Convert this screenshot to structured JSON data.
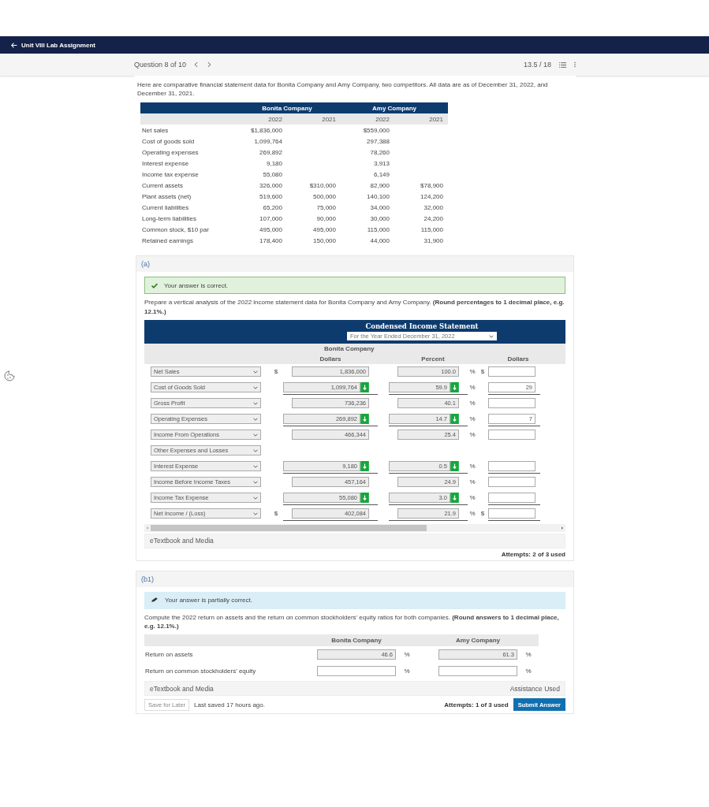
{
  "header": {
    "back_label": "Unit VIII Lab Assignment"
  },
  "question_bar": {
    "position": "Question 8 of 10",
    "score": "13.5 / 18"
  },
  "intro": "Here are comparative financial statement data for Bonita Company and Amy Company, two competitors. All data are as of December 31, 2022, and December 31, 2021.",
  "data_table": {
    "companies": [
      "Bonita Company",
      "Amy Company"
    ],
    "years": [
      "2022",
      "2021",
      "2022",
      "2021"
    ],
    "rows": [
      {
        "label": "Net sales",
        "bonita_2022": "$1,836,000",
        "amy_2022": "$559,000"
      },
      {
        "label": "Cost of goods sold",
        "bonita_2022": "1,099,764",
        "amy_2022": "297,388"
      },
      {
        "label": "Operating expenses",
        "bonita_2022": "269,892",
        "amy_2022": "78,260"
      },
      {
        "label": "Interest expense",
        "bonita_2022": "9,180",
        "amy_2022": "3,913"
      },
      {
        "label": "Income tax expense",
        "bonita_2022": "55,080",
        "amy_2022": "6,149"
      },
      {
        "label": "Current assets",
        "bonita_2022": "326,000",
        "bonita_2021": "$310,000",
        "amy_2022": "82,900",
        "amy_2021": "$78,900"
      },
      {
        "label": "Plant assets (net)",
        "bonita_2022": "519,600",
        "bonita_2021": "500,000",
        "amy_2022": "140,100",
        "amy_2021": "124,200"
      },
      {
        "label": "Current liabilities",
        "bonita_2022": "65,200",
        "bonita_2021": "75,000",
        "amy_2022": "34,000",
        "amy_2021": "32,000"
      },
      {
        "label": "Long-term liabilities",
        "bonita_2022": "107,000",
        "bonita_2021": "90,000",
        "amy_2022": "30,000",
        "amy_2021": "24,200"
      },
      {
        "label": "Common stock, $10 par",
        "bonita_2022": "495,000",
        "bonita_2021": "495,000",
        "amy_2022": "115,000",
        "amy_2021": "115,000"
      },
      {
        "label": "Retained earnings",
        "bonita_2022": "178,400",
        "bonita_2021": "150,000",
        "amy_2022": "44,000",
        "amy_2021": "31,900"
      }
    ]
  },
  "part_a": {
    "label": "(a)",
    "feedback": {
      "kind": "correct",
      "text": "Your answer is correct."
    },
    "instructions": "Prepare a vertical analysis of the 2022 income statement data for Bonita Company and Amy Company. **(Round percentages to 1 decimal place, e.g. 12.1%.)**",
    "statement": {
      "title": "Condensed Income Statement",
      "period": "For the Year Ended December 31, 2022",
      "company": "Bonita Company",
      "columns": [
        "Dollars",
        "Percent",
        "Dollars"
      ],
      "rows": [
        {
          "kind": "line",
          "label": "Net Sales",
          "currency": "$",
          "dollars": "1,836,000",
          "dollars_flag": false,
          "percent": "100.0",
          "percent_flag": false,
          "unit": "%",
          "right_currency": "$",
          "rule": false
        },
        {
          "kind": "line",
          "label": "Cost of Goods Sold",
          "dollars": "1,099,764",
          "dollars_flag": true,
          "percent": "59.9",
          "percent_flag": true,
          "unit": "%",
          "right_value": "29",
          "rule": true
        },
        {
          "kind": "line",
          "label": "Gross Profit",
          "dollars": "736,236",
          "dollars_flag": false,
          "percent": "40.1",
          "percent_flag": false,
          "unit": "%",
          "rule": false
        },
        {
          "kind": "line",
          "label": "Operating Expenses",
          "dollars": "269,892",
          "dollars_flag": true,
          "percent": "14.7",
          "percent_flag": true,
          "unit": "%",
          "right_value": "7",
          "rule": true
        },
        {
          "kind": "line",
          "label": "Income From Operations",
          "dollars": "466,344",
          "dollars_flag": false,
          "percent": "25.4",
          "percent_flag": false,
          "unit": "%",
          "rule": false
        },
        {
          "kind": "heading",
          "label": "Other Expenses and Losses"
        },
        {
          "kind": "line",
          "label": "Interest Expense",
          "dollars": "9,180",
          "dollars_flag": true,
          "percent": "0.5",
          "percent_flag": true,
          "unit": "%",
          "rule": true
        },
        {
          "kind": "line",
          "label": "Income Before Income Taxes",
          "dollars": "457,164",
          "dollars_flag": false,
          "percent": "24.9",
          "percent_flag": false,
          "unit": "%",
          "rule": false
        },
        {
          "kind": "line",
          "label": "Income Tax Expense",
          "dollars": "55,080",
          "dollars_flag": true,
          "percent": "3.0",
          "percent_flag": true,
          "unit": "%",
          "rule": true
        },
        {
          "kind": "line",
          "label": "Net Income / (Loss)",
          "currency": "$",
          "dollars": "402,084",
          "dollars_flag": false,
          "percent": "21.9",
          "percent_flag": false,
          "unit": "%",
          "right_currency": "$",
          "rule": true
        }
      ]
    },
    "media": "eTextbook and Media",
    "attempts": "Attempts: 2 of 3 used"
  },
  "part_b1": {
    "label": "(b1)",
    "feedback": {
      "kind": "partial",
      "text": "Your answer is partially correct."
    },
    "instructions": "Compute the 2022 return on assets and the return on common stockholders' equity ratios for both companies. **(Round answers to 1 decimal place, e.g. 12.1%.)**",
    "companies": [
      "Bonita Company",
      "Amy Company"
    ],
    "rows": [
      {
        "label": "Return on assets",
        "bonita": "46.6",
        "amy": "61.3",
        "unit": "%"
      },
      {
        "label": "Return on common stockholders' equity",
        "unit": "%"
      }
    ],
    "media": "eTextbook and Media",
    "assistance": "Assistance Used",
    "save_label": "Save for Later",
    "last_saved": "Last saved 17 hours ago.",
    "attempts": "Attempts: 1 of 3 used",
    "submit_label": "Submit Answer"
  }
}
